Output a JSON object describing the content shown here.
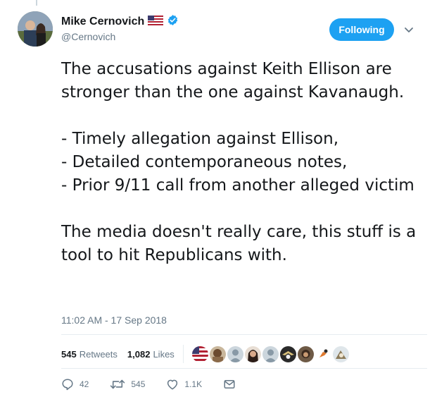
{
  "author": {
    "name": "Mike Cernovich",
    "handle": "@Cernovich",
    "flag_icon": "us-flag-icon",
    "verified_icon": "verified-badge-icon"
  },
  "follow_button": {
    "label": "Following"
  },
  "tweet": {
    "paragraphs": [
      "The accusations against Keith Ellison are stronger than the one against Kavanaugh.",
      "- Timely allegation against Ellison,\n- Detailed contemporaneous notes,\n- Prior 9/11 call from another alleged victim",
      "The media doesn't really care, this stuff is a tool to hit Republicans with."
    ],
    "timestamp": "11:02 AM - 17 Sep 2018"
  },
  "stats": {
    "retweets_count": "545",
    "retweets_label": "Retweets",
    "likes_count": "1,082",
    "likes_label": "Likes"
  },
  "actions": {
    "reply_count": "42",
    "retweet_count": "545",
    "like_count": "1.1K"
  },
  "colors": {
    "accent": "#1da1f2",
    "text": "#14171a",
    "muted": "#657786",
    "divider": "#e6ecf0"
  }
}
